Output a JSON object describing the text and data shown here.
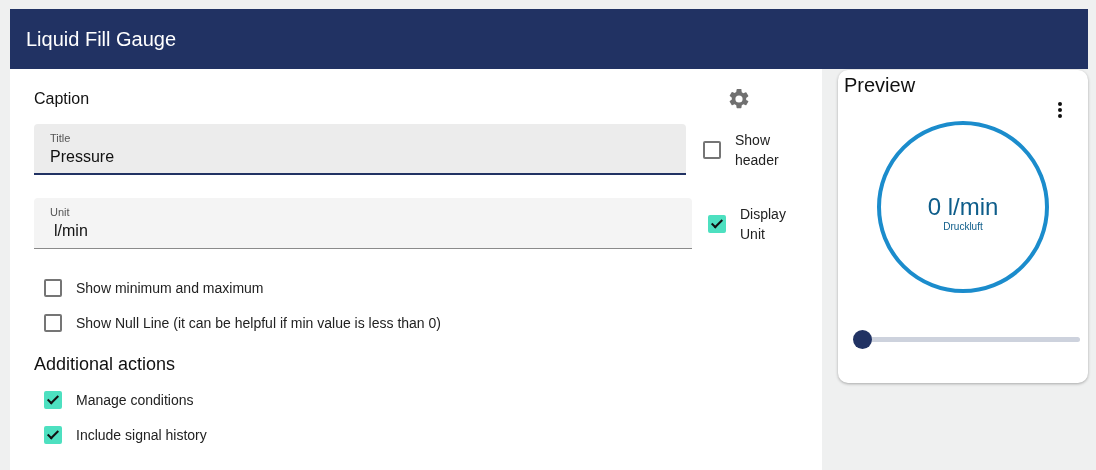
{
  "header": {
    "title": "Liquid Fill Gauge"
  },
  "caption": {
    "label": "Caption"
  },
  "fields": [
    {
      "label": "Title",
      "value": "Pressure",
      "focused": true,
      "option": {
        "label": "Show header",
        "checked": false
      }
    },
    {
      "label": "Unit",
      "value": "l/min",
      "focused": false,
      "option": {
        "label": "Display Unit",
        "checked": true
      }
    }
  ],
  "options": [
    {
      "label": "Show minimum and maximum",
      "checked": false
    },
    {
      "label": "Show Null Line (it can be helpful if min value is less than 0)",
      "checked": false
    }
  ],
  "additional": {
    "heading": "Additional actions",
    "items": [
      {
        "label": "Manage conditions",
        "checked": true
      },
      {
        "label": "Include signal history",
        "checked": true
      }
    ]
  },
  "preview": {
    "title": "Preview",
    "value": "0 l/min",
    "signal": "Druckluft",
    "slider": {
      "level": 0
    }
  }
}
